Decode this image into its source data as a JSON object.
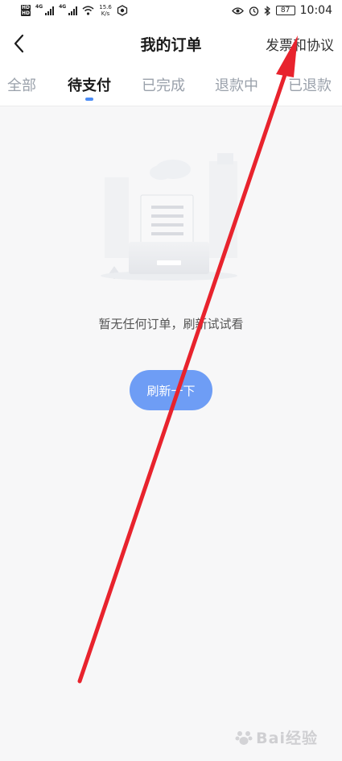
{
  "status_bar": {
    "hd": "HD",
    "net_1": "4G",
    "net_2": "4G",
    "speed_value": "15.6",
    "speed_unit": "K/s",
    "battery": "87",
    "time": "10:04"
  },
  "header": {
    "title": "我的订单",
    "invoice_link": "发票和协议"
  },
  "tabs": [
    {
      "label": "全部"
    },
    {
      "label": "待支付"
    },
    {
      "label": "已完成"
    },
    {
      "label": "退款中"
    },
    {
      "label": "已退款"
    }
  ],
  "empty_state": {
    "message": "暂无任何订单，刷新试试看",
    "refresh_label": "刷新一下"
  },
  "colors": {
    "accent": "#4b8cf5",
    "button": "#6e9df5",
    "arrow": "#e8232d"
  },
  "watermark": {
    "text": "Bai经验"
  }
}
